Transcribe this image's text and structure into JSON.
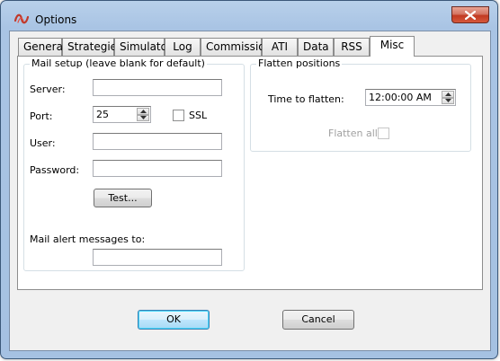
{
  "window": {
    "title": "Options",
    "close_label": "Close"
  },
  "tabs": [
    {
      "label": "General"
    },
    {
      "label": "Strategies"
    },
    {
      "label": "Simulator"
    },
    {
      "label": "Log"
    },
    {
      "label": "Commission"
    },
    {
      "label": "ATI"
    },
    {
      "label": "Data"
    },
    {
      "label": "RSS"
    },
    {
      "label": "Misc",
      "active": true
    }
  ],
  "mail_setup": {
    "group_title": "Mail setup (leave blank for default)",
    "server_label": "Server:",
    "server_value": "",
    "port_label": "Port:",
    "port_value": "25",
    "ssl_label": "SSL",
    "ssl_checked": false,
    "user_label": "User:",
    "user_value": "",
    "password_label": "Password:",
    "password_value": "",
    "test_button": "Test...",
    "alert_label": "Mail alert messages to:",
    "alert_value": ""
  },
  "flatten": {
    "group_title": "Flatten positions",
    "time_label": "Time to flatten:",
    "time_value": "12:00:00 AM",
    "flatten_all_label": "Flatten all",
    "flatten_all_checked": false,
    "flatten_all_enabled": false
  },
  "footer": {
    "ok_button": "OK",
    "cancel_button": "Cancel"
  },
  "icons": {
    "app": "ninja-logo-icon",
    "close": "close-icon",
    "spin_up": "spin-up-icon",
    "spin_down": "spin-down-icon"
  },
  "colors": {
    "title_bar": "#a9c4e4",
    "close_button": "#c23a22",
    "default_button_border": "#3c7fb1"
  }
}
